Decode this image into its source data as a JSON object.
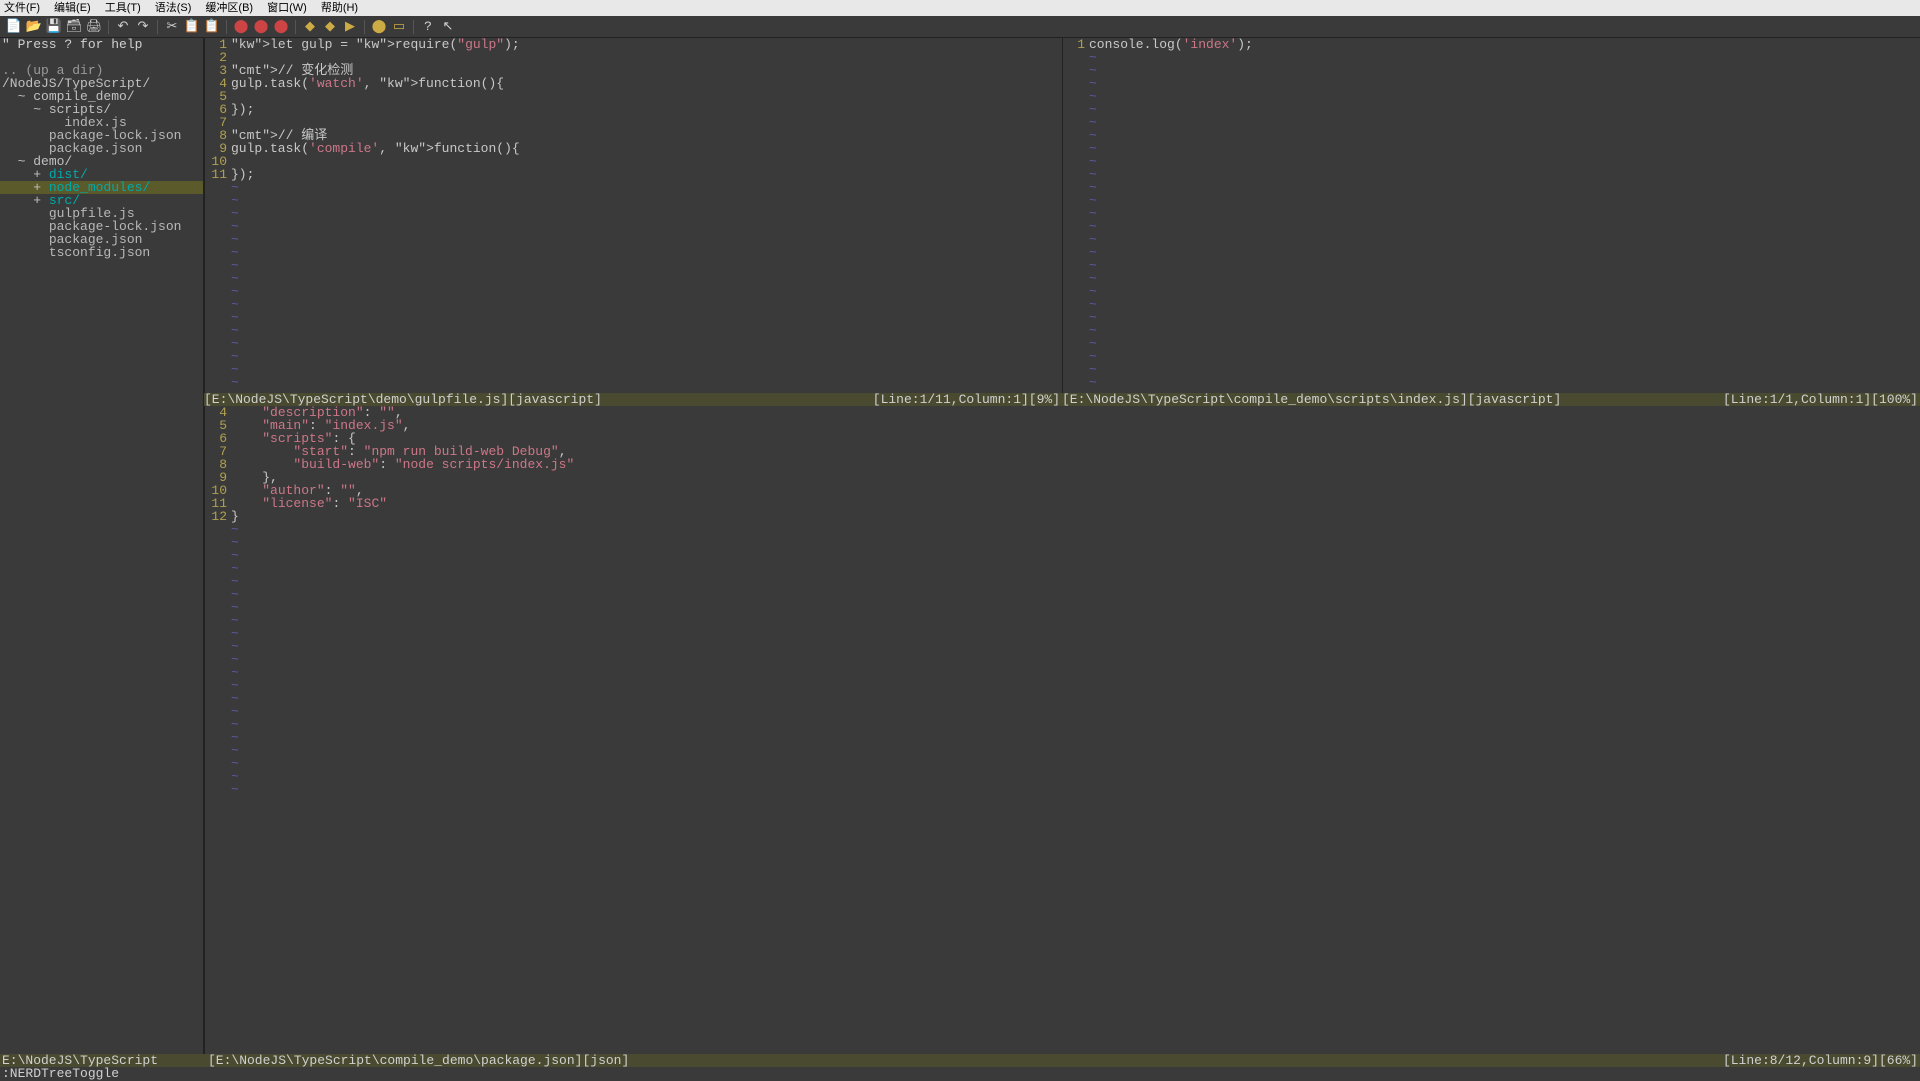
{
  "menubar": [
    "文件(F)",
    "编辑(E)",
    "工具(T)",
    "语法(S)",
    "缓冲区(B)",
    "窗口(W)",
    "帮助(H)"
  ],
  "toolbar_icons": [
    "new",
    "open",
    "save",
    "saveall",
    "print",
    "undo",
    "redo",
    "cut",
    "copy",
    "paste",
    "find",
    "findnext",
    "findprev",
    "record",
    "play",
    "stop",
    "make",
    "tags",
    "ctags",
    "help",
    "arrow"
  ],
  "filetree": {
    "header": "\" Press ? for help",
    "bookmark_line": "",
    "up_dir": ".. (up a dir)",
    "root": "/NodeJS/TypeScript/",
    "items": [
      {
        "indent": 1,
        "exp": "~",
        "name": "compile_demo/",
        "cls": "dir-o"
      },
      {
        "indent": 2,
        "exp": "~",
        "name": "scripts/",
        "cls": "dir-o"
      },
      {
        "indent": 3,
        "exp": "",
        "name": "index.js",
        "cls": "file"
      },
      {
        "indent": 2,
        "exp": "",
        "name": "package-lock.json",
        "cls": "file"
      },
      {
        "indent": 2,
        "exp": "",
        "name": "package.json",
        "cls": "file"
      },
      {
        "indent": 1,
        "exp": "~",
        "name": "demo/",
        "cls": "dir-o"
      },
      {
        "indent": 2,
        "exp": "+",
        "name": "dist/",
        "cls": "dir"
      },
      {
        "indent": 2,
        "exp": "+",
        "name": "node_modules/",
        "cls": "dir",
        "sel": true
      },
      {
        "indent": 2,
        "exp": "+",
        "name": "src/",
        "cls": "dir"
      },
      {
        "indent": 2,
        "exp": "",
        "name": "gulpfile.js",
        "cls": "file"
      },
      {
        "indent": 2,
        "exp": "",
        "name": "package-lock.json",
        "cls": "file"
      },
      {
        "indent": 2,
        "exp": "",
        "name": "package.json",
        "cls": "file"
      },
      {
        "indent": 2,
        "exp": "",
        "name": "tsconfig.json",
        "cls": "file"
      }
    ]
  },
  "pane_top_left": {
    "numbers": [
      1,
      2,
      3,
      4,
      5,
      6,
      7,
      8,
      9,
      10,
      11
    ],
    "lines": [
      "let gulp = require(\"gulp\");",
      "",
      "// 变化检测",
      "gulp.task('watch', function(){",
      "",
      "});",
      "",
      "// 编译",
      "gulp.task('compile', function(){",
      "",
      "});"
    ],
    "status_left": "[E:\\NodeJS\\TypeScript\\demo\\gulpfile.js][javascript]",
    "status_right": "[Line:1/11,Column:1][9%]"
  },
  "pane_top_right": {
    "numbers": [
      1
    ],
    "lines": [
      "console.log('index');"
    ],
    "status_left": "[E:\\NodeJS\\TypeScript\\compile_demo\\scripts\\index.js][javascript]",
    "status_right": "[Line:1/1,Column:1][100%]"
  },
  "pane_bottom": {
    "numbers": [
      4,
      5,
      6,
      7,
      8,
      9,
      10,
      11,
      12
    ],
    "lines": [
      "    \"description\": \"\",",
      "    \"main\": \"index.js\",",
      "    \"scripts\": {",
      "        \"start\": \"npm run build-web Debug\",",
      "        \"build-web\": \"node scripts/index.js\"",
      "    },",
      "    \"author\": \"\",",
      "    \"license\": \"ISC\"",
      "}"
    ],
    "status_left": "[E:\\NodeJS\\TypeScript\\compile_demo\\package.json][json]",
    "status_right": "[Line:8/12,Column:9][66%]"
  },
  "nerdtree_status": "E:\\NodeJS\\TypeScript",
  "cmdline": ":NERDTreeToggle"
}
